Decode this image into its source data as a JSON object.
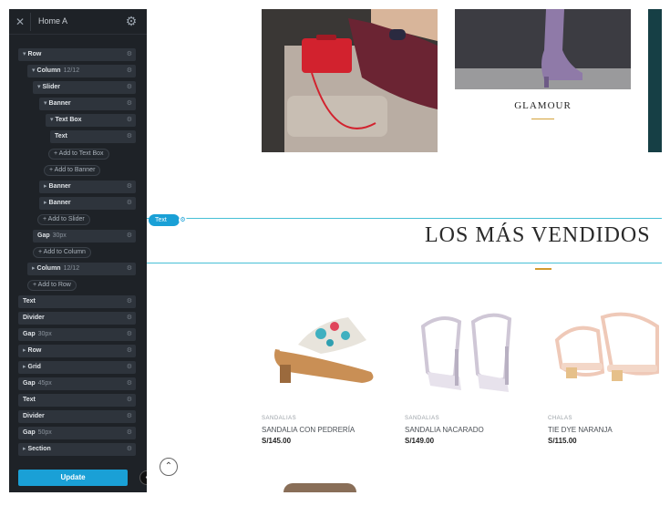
{
  "sidebar": {
    "title": "Home A",
    "items": {
      "row": {
        "label": "Row"
      },
      "column": {
        "label": "Column",
        "meta": "12/12"
      },
      "slider": {
        "label": "Slider"
      },
      "banner1": {
        "label": "Banner"
      },
      "textbox": {
        "label": "Text Box"
      },
      "text1": {
        "label": "Text"
      },
      "add_textbox": {
        "label": "+ Add to Text Box"
      },
      "add_banner": {
        "label": "+ Add to Banner"
      },
      "banner2": {
        "label": "Banner"
      },
      "banner3": {
        "label": "Banner"
      },
      "add_slider": {
        "label": "+ Add to Slider"
      },
      "gap1": {
        "label": "Gap",
        "meta": "30px"
      },
      "add_column": {
        "label": "+ Add to Column"
      },
      "column2": {
        "label": "Column",
        "meta": "12/12"
      },
      "add_row": {
        "label": "+ Add to Row"
      },
      "text2": {
        "label": "Text"
      },
      "divider1": {
        "label": "Divider"
      },
      "gap2": {
        "label": "Gap",
        "meta": "30px"
      },
      "row2": {
        "label": "Row"
      },
      "grid": {
        "label": "Grid"
      },
      "gap3": {
        "label": "Gap",
        "meta": "45px"
      },
      "text3": {
        "label": "Text"
      },
      "divider2": {
        "label": "Divider"
      },
      "gap4": {
        "label": "Gap",
        "meta": "50px"
      },
      "section": {
        "label": "Section"
      }
    },
    "update_label": "Update"
  },
  "canvas": {
    "banner_label": "GLAMOUR",
    "text_tag": "Text",
    "heading": "LOS MÁS VENDIDOS",
    "products": [
      {
        "category": "SANDALIAS",
        "name": "SANDALIA CON PEDRERÍA",
        "price": "S/145.00"
      },
      {
        "category": "SANDALIAS",
        "name": "SANDALIA NACARADO",
        "price": "S/149.00"
      },
      {
        "category": "CHALAS",
        "name": "TIE DYE NARANJA",
        "price": "S/115.00"
      }
    ]
  },
  "colors": {
    "accent": "#1aa0d6",
    "outline": "#46c0d6",
    "gold": "#d49a2e",
    "panel": "#1e2227",
    "item": "#2e343c"
  }
}
